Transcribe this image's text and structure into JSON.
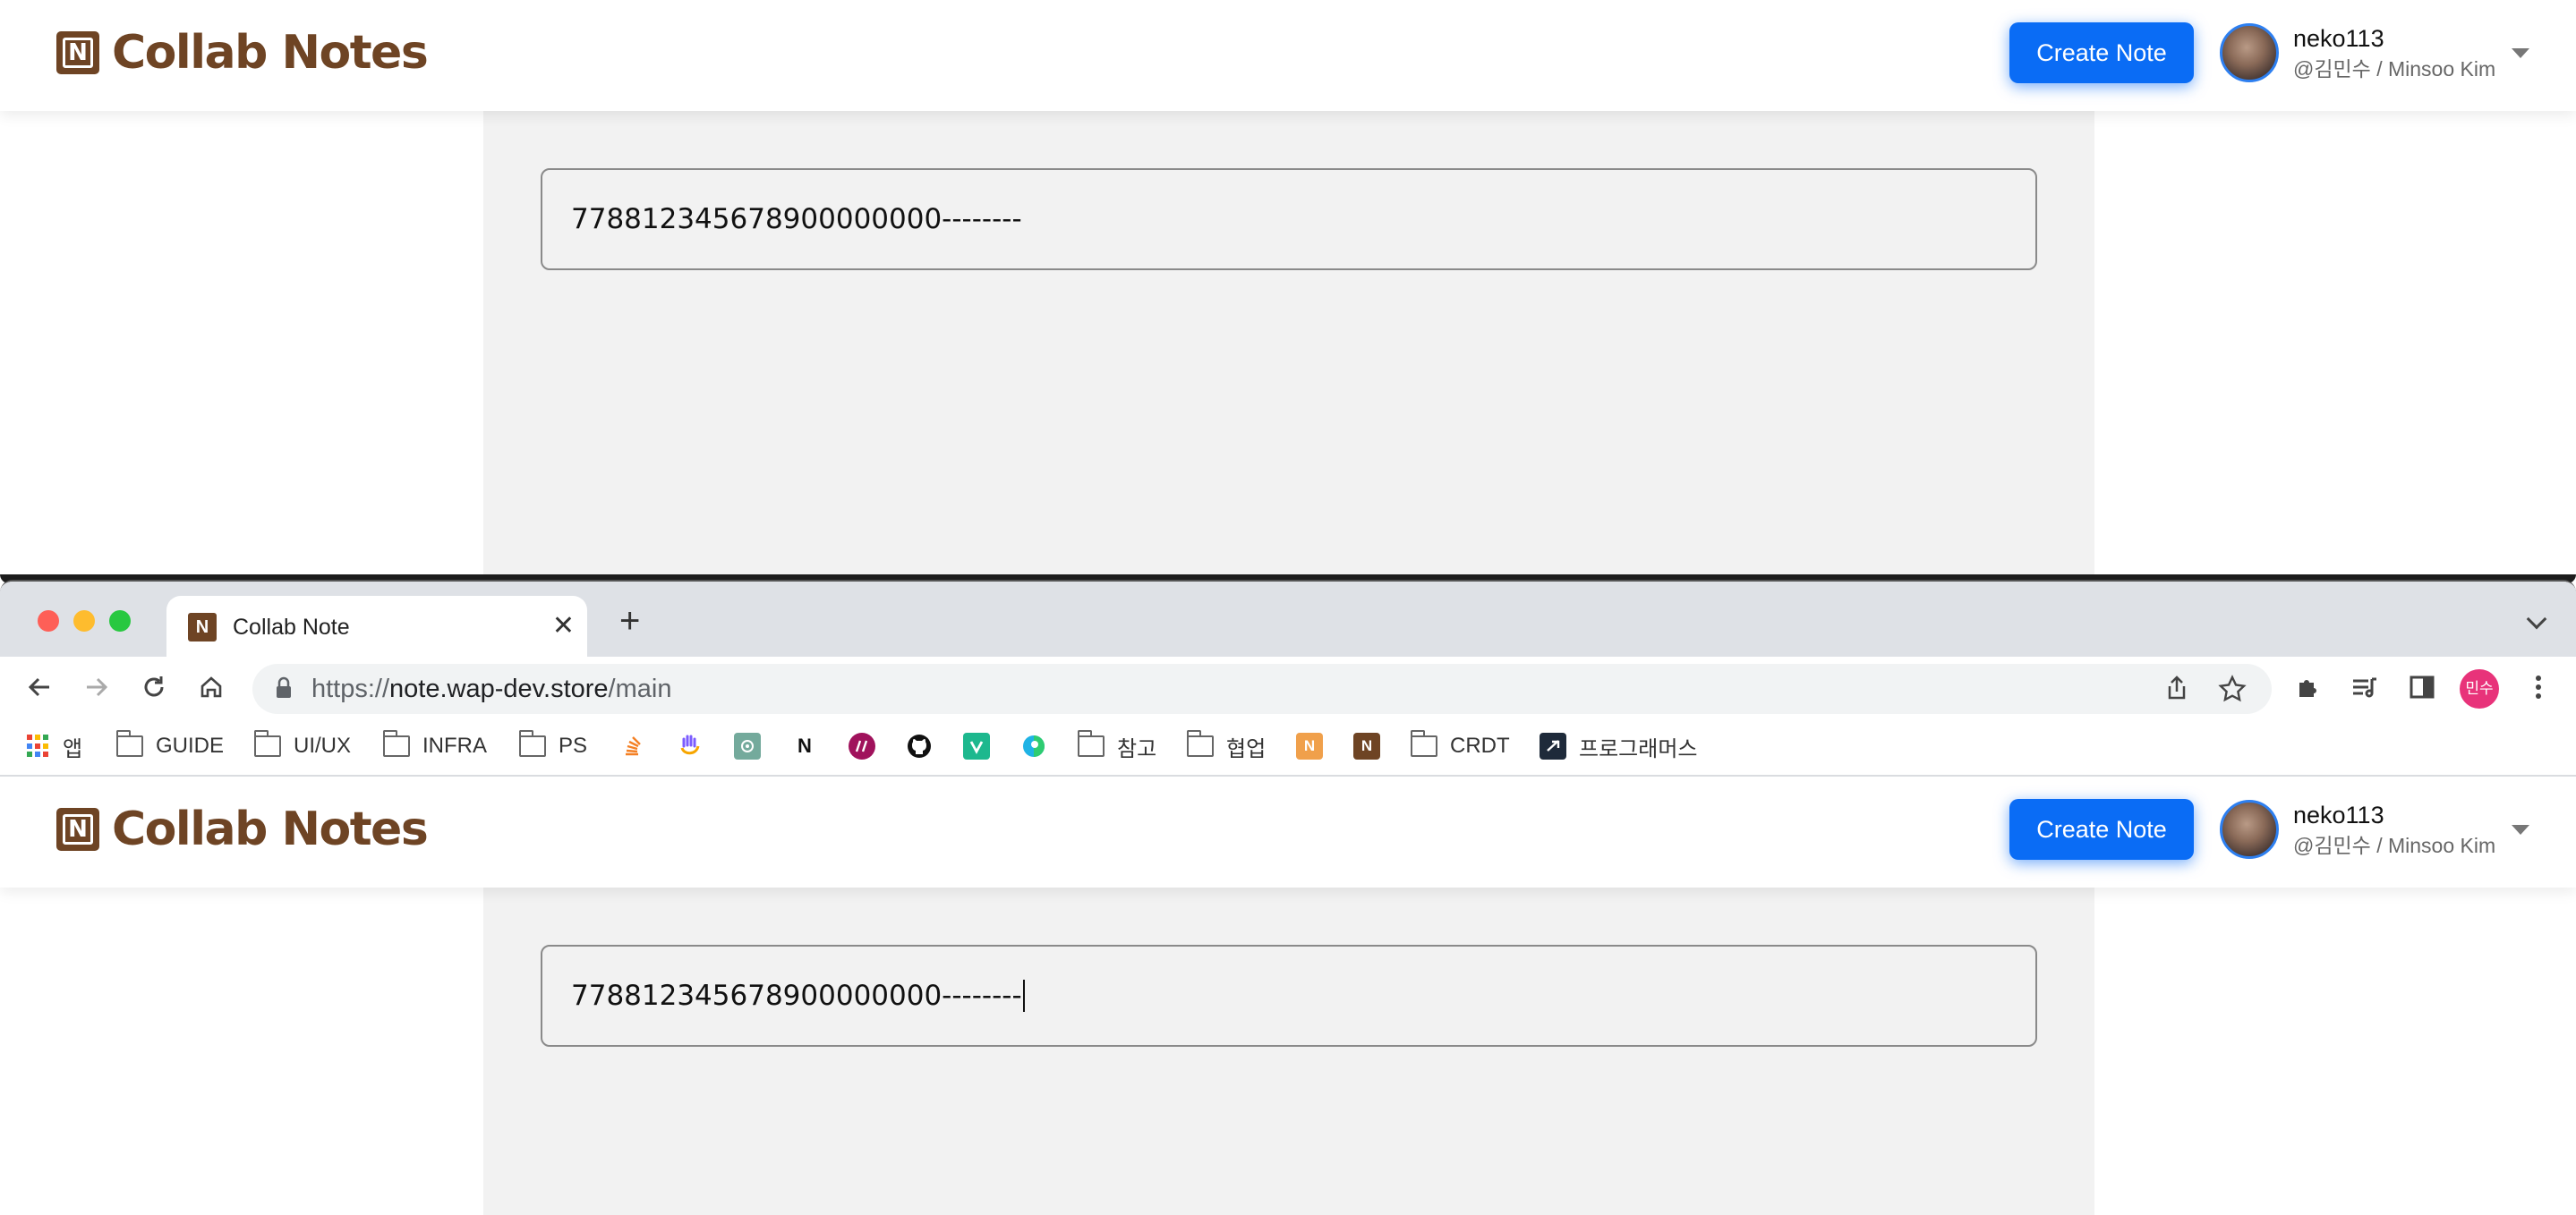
{
  "app": {
    "logo_letter": "N",
    "logo_text": "Collab Notes",
    "create_button": "Create Note",
    "user": {
      "name": "neko113",
      "handle": "@김민수 / Minsoo Kim"
    }
  },
  "note": {
    "top_value": "778812345678900000000--------",
    "bottom_value": "778812345678900000000--------"
  },
  "browser": {
    "tab": {
      "favicon_letter": "N",
      "title": "Collab Note",
      "close_glyph": "✕"
    },
    "new_tab_glyph": "+",
    "address": {
      "scheme": "https://",
      "host": "note.wap-dev.store",
      "path": "/main"
    },
    "profile_label": "민수",
    "bookmarks": {
      "apps": "앱",
      "guide": "GUIDE",
      "uiux": "UI/UX",
      "infra": "INFRA",
      "ps": "PS",
      "notion": "N",
      "reference": "참고",
      "collab": "협업",
      "crdt": "CRDT",
      "programmers": "프로그래머스"
    }
  },
  "colors": {
    "brand_brown": "#6e4424",
    "primary_blue": "#0a6cf5",
    "paper_gray": "#f2f2f2",
    "profile_pink": "#e8337a"
  },
  "icons": [
    "back-arrow-icon",
    "forward-arrow-icon",
    "reload-icon",
    "home-icon",
    "lock-icon",
    "share-icon",
    "star-icon",
    "extensions-icon",
    "reading-list-icon",
    "side-panel-icon",
    "kebab-menu-icon",
    "folder-icon",
    "chevron-down-icon"
  ]
}
